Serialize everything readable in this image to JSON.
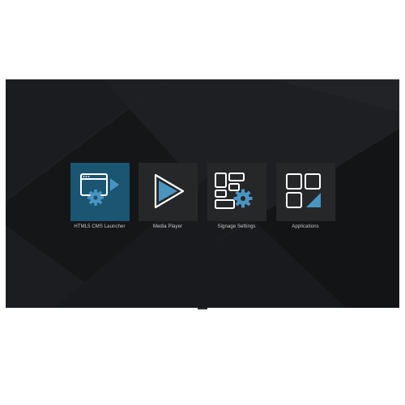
{
  "launcher": {
    "tiles": [
      {
        "label": "HTML5 CMS Launcher",
        "icon": "html5-cms-launcher-icon",
        "selected": true
      },
      {
        "label": "Media Player",
        "icon": "play-icon",
        "selected": false
      },
      {
        "label": "Signage Settings",
        "icon": "signage-settings-icon",
        "selected": false
      },
      {
        "label": "Applications",
        "icon": "applications-grid-icon",
        "selected": false
      }
    ]
  },
  "colors": {
    "screen_bg": "#17181a",
    "tile_bg": "#262729",
    "tile_selected_bg": "#1a5571",
    "accent": "#4a95c0",
    "icon_stroke": "#ffffff"
  }
}
